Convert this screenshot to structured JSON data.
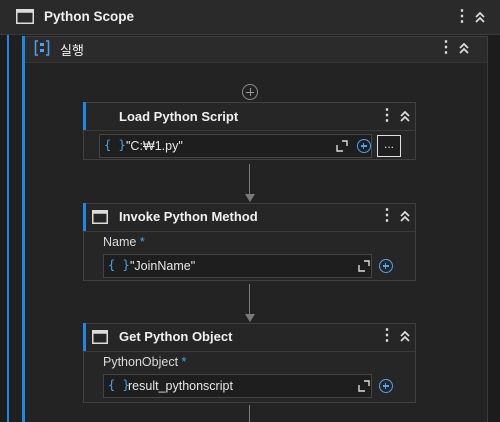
{
  "scope": {
    "title": "Python Scope",
    "icon": "window-icon"
  },
  "sequence": {
    "title": "실행",
    "icon": "sequence-icon"
  },
  "activities": [
    {
      "title": "Load Python Script",
      "icon": "braces-icon",
      "field_value": "\"C:₩1.py\"",
      "more_label": "..."
    },
    {
      "title": "Invoke Python Method",
      "icon": "window-icon",
      "field_label": "Name",
      "required": "*",
      "field_value": "\"JoinName\""
    },
    {
      "title": "Get Python Object",
      "icon": "window-icon",
      "field_label": "PythonObject",
      "required": "*",
      "field_value": "result_pythonscript"
    }
  ],
  "colors": {
    "accent": "#1e88e5",
    "background": "#202020",
    "card": "#262626"
  }
}
